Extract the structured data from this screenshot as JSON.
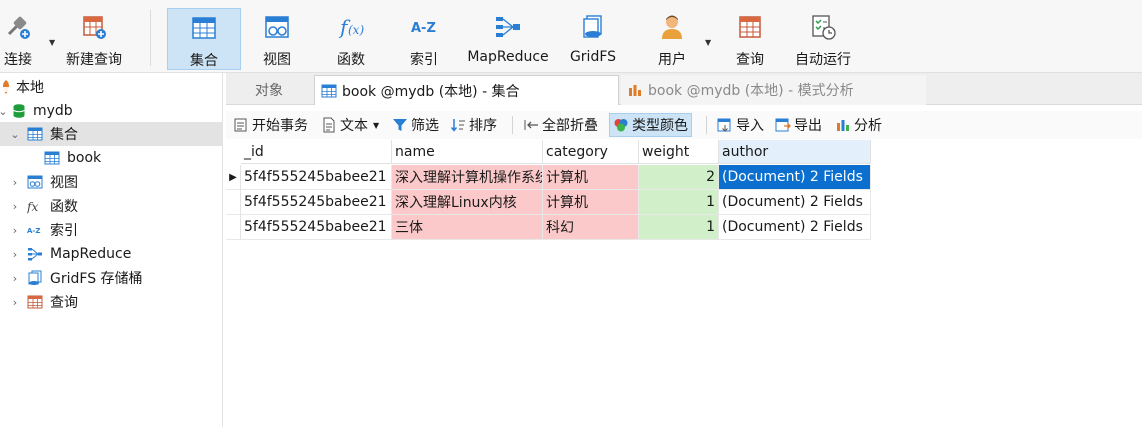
{
  "toolbar": {
    "items": [
      {
        "label": "连接",
        "icon": "plug-connect-icon"
      },
      {
        "label": "新建查询",
        "icon": "new-query-icon"
      },
      {
        "label": "集合",
        "icon": "collection-table-icon"
      },
      {
        "label": "视图",
        "icon": "view-icon"
      },
      {
        "label": "函数",
        "icon": "function-icon"
      },
      {
        "label": "索引",
        "icon": "index-az-icon"
      },
      {
        "label": "MapReduce",
        "icon": "mapreduce-icon"
      },
      {
        "label": "GridFS",
        "icon": "gridfs-icon"
      },
      {
        "label": "用户",
        "icon": "user-icon"
      },
      {
        "label": "查询",
        "icon": "query-icon"
      },
      {
        "label": "自动运行",
        "icon": "automation-icon"
      }
    ],
    "active": "集合",
    "accent": "#cde4f7"
  },
  "sidebar": {
    "connection": "本地",
    "database": "mydb",
    "items": [
      {
        "label": "集合",
        "icon": "collection-icon"
      },
      {
        "label": "book",
        "icon": "table-icon"
      },
      {
        "label": "视图",
        "icon": "view-icon"
      },
      {
        "label": "函数",
        "icon": "function-icon"
      },
      {
        "label": "索引",
        "icon": "index-icon"
      },
      {
        "label": "MapReduce",
        "icon": "mapreduce-icon"
      },
      {
        "label": "GridFS 存储桶",
        "icon": "gridfs-icon"
      },
      {
        "label": "查询",
        "icon": "query-icon"
      }
    ]
  },
  "tabs": {
    "objects": "对象",
    "active": "book @mydb (本地) - 集合",
    "inactive": "book @mydb (本地) - 模式分析"
  },
  "subtoolbar": {
    "begin_tx": "开始事务",
    "text": "文本",
    "filter": "筛选",
    "sort": "排序",
    "collapse_all": "全部折叠",
    "type_color": "类型颜色",
    "import": "导入",
    "export": "导出",
    "analyze": "分析"
  },
  "grid": {
    "columns": [
      "_id",
      "name",
      "category",
      "weight",
      "author"
    ],
    "rows": [
      {
        "_id": "5f4f555245babee21",
        "name": "深入理解计算机操作系统",
        "category": "计算机",
        "weight": "2",
        "author": "(Document) 2 Fields"
      },
      {
        "_id": "5f4f555245babee21",
        "name": "深入理解Linux内核",
        "category": "计算机",
        "weight": "1",
        "author": "(Document) 2 Fields"
      },
      {
        "_id": "5f4f555245babee21",
        "name": "三体",
        "category": "科幻",
        "weight": "1",
        "author": "(Document) 2 Fields"
      }
    ],
    "colors": {
      "string": "#fbc9c9",
      "number": "#d1efc9",
      "selected": "#0a6fcf"
    }
  }
}
